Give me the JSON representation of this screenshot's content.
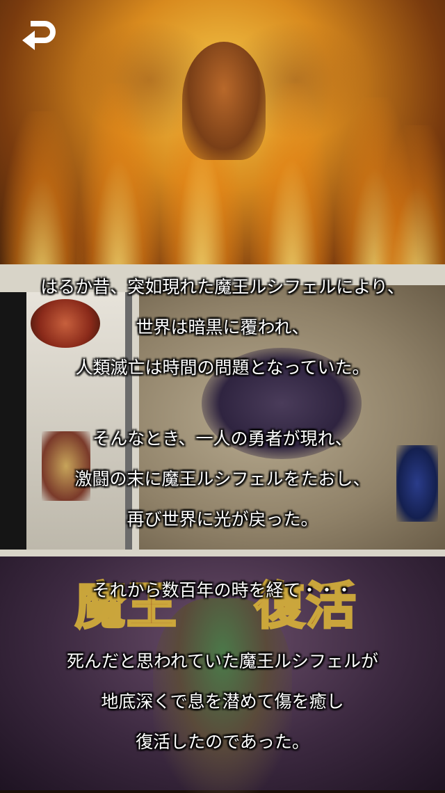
{
  "header": {
    "back_icon": "return-arrow-icon"
  },
  "banner": {
    "title_left": "魔王",
    "title_right": "復活"
  },
  "story": {
    "paragraphs": [
      [
        "はるか昔、突如現れた魔王ルシフェルにより、",
        "世界は暗黒に覆われ、",
        "人類滅亡は時間の問題となっていた。"
      ],
      [
        "そんなとき、一人の勇者が現れ、",
        "激闘の末に魔王ルシフェルをたおし、",
        "再び世界に光が戻った。"
      ],
      [
        "それから数百年の時を経て・・・"
      ],
      [
        "死んだと思われていた魔王ルシフェルが",
        "地底深くで息を潜めて傷を癒し",
        "復活したのであった。"
      ]
    ]
  },
  "colors": {
    "text": "#ffffff",
    "title_fill": "#8a1a0a",
    "title_outline": "#d8b23a"
  }
}
